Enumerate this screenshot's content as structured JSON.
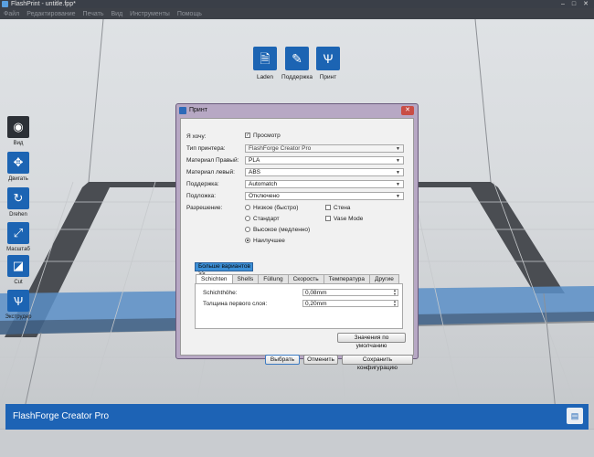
{
  "window": {
    "title": "FlashPrint - untitle.fpp*",
    "controls": [
      "–",
      "□",
      "✕"
    ]
  },
  "menu": [
    "Файл",
    "Редактирование",
    "Печать",
    "Вид",
    "Инструменты",
    "Помощь"
  ],
  "top_toolbar": [
    {
      "label": "Laden",
      "icon": "file-icon",
      "glyph": "🗎"
    },
    {
      "label": "Поддержка",
      "icon": "support-icon",
      "glyph": "✎"
    },
    {
      "label": "Принт",
      "icon": "print-icon",
      "glyph": "Ѱ"
    }
  ],
  "left_toolbar": [
    {
      "label": "Вид",
      "icon": "eye-icon",
      "glyph": "◉"
    },
    {
      "label": "Двигать",
      "icon": "move-icon",
      "glyph": "✥"
    },
    {
      "label": "Drehen",
      "icon": "rotate-icon",
      "glyph": "↻"
    },
    {
      "label": "Масштаб",
      "icon": "scale-icon",
      "glyph": "⤢"
    },
    {
      "label": "Cut",
      "icon": "cut-icon",
      "glyph": "◪"
    },
    {
      "label": "Экструдер",
      "icon": "extruder-icon",
      "glyph": "Ѱ"
    }
  ],
  "bottom_bar": {
    "label": "FlashForge Creator Pro",
    "icon": "save-icon"
  },
  "dialog": {
    "title": "Принт",
    "close_glyph": "✕",
    "want_label": "Я хочу:",
    "preview_label": "Просмотр",
    "preview_checked": true,
    "printer_type_label": "Тип принтера:",
    "printer_type_value": "FlashForge Creator Pro",
    "material_right_label": "Материал Правый:",
    "material_right_value": "PLA",
    "material_left_label": "Материал левый:",
    "material_left_value": "ABS",
    "support_label": "Поддержка:",
    "support_value": "Automatch",
    "raft_label": "Подложка:",
    "raft_value": "Отключено",
    "resolution_label": "Разрешение:",
    "resolution_options": [
      {
        "label": "Низкое (быстро)",
        "selected": false
      },
      {
        "label": "Стандарт",
        "selected": false
      },
      {
        "label": "Высокое (медленно)",
        "selected": false
      },
      {
        "label": "Наилучшее",
        "selected": true
      }
    ],
    "wall_label": "Стена",
    "vase_label": "Vase Mode",
    "more_options_label": "Больше вариантов >>",
    "tabs": [
      {
        "label": "Schichten",
        "active": true
      },
      {
        "label": "Shells",
        "active": false
      },
      {
        "label": "Füllung",
        "active": false
      },
      {
        "label": "Скорость",
        "active": false
      },
      {
        "label": "Температура",
        "active": false
      },
      {
        "label": "Другие",
        "active": false
      }
    ],
    "layer_height_label": "Schichthöhe:",
    "layer_height_value": "0,08mm",
    "first_layer_label": "Толщина первого слоя:",
    "first_layer_value": "0,20mm",
    "defaults_button": "Значения по умолчанию",
    "select_button": "Выбрать",
    "cancel_button": "Отменить",
    "save_config_button": "Сохранить конфигурацию"
  }
}
